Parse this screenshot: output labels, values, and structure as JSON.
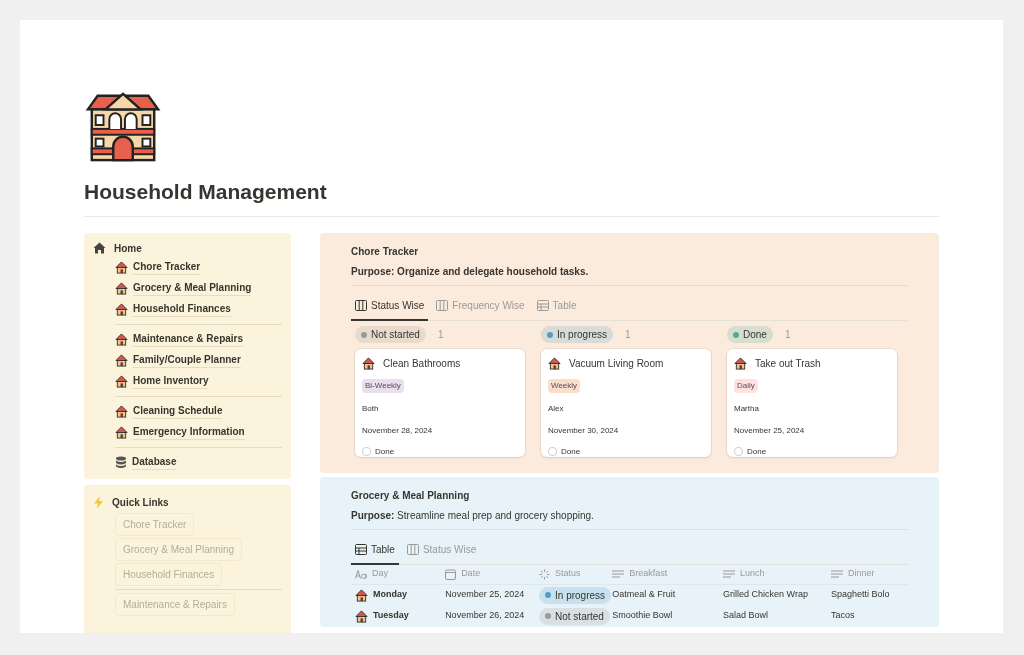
{
  "page": {
    "title": "Household Management"
  },
  "sidebar": {
    "home": {
      "label": "Home"
    },
    "groups": [
      [
        {
          "label": "Chore Tracker",
          "kind": "page"
        },
        {
          "label": "Grocery & Meal Planning",
          "kind": "page"
        },
        {
          "label": "Household Finances",
          "kind": "page"
        }
      ],
      [
        {
          "label": "Maintenance & Repairs",
          "kind": "page"
        },
        {
          "label": "Family/Couple Planner",
          "kind": "page"
        },
        {
          "label": "Home Inventory",
          "kind": "page"
        }
      ],
      [
        {
          "label": "Cleaning Schedule",
          "kind": "page"
        },
        {
          "label": "Emergency Information",
          "kind": "page"
        }
      ],
      [
        {
          "label": "Database",
          "kind": "database"
        }
      ]
    ],
    "quick_links": {
      "title": "Quick Links",
      "groups": [
        [
          "Chore Tracker",
          "Grocery & Meal Planning",
          "Household Finances"
        ],
        [
          "Maintenance & Repairs"
        ]
      ]
    }
  },
  "chore_tracker": {
    "title": "Chore Tracker",
    "purpose": "**Purpose: Organize and delegate household tasks.**",
    "tabs": [
      {
        "label": "Status Wise",
        "kind": "board",
        "selected": true
      },
      {
        "label": "Frequency Wise",
        "kind": "board",
        "selected": false
      },
      {
        "label": "Table",
        "kind": "table",
        "selected": false
      }
    ],
    "columns": [
      {
        "status": "Not started",
        "color": "#9b9a97",
        "count": "1",
        "cards": [
          {
            "title": "Clean Bathrooms",
            "frequency": {
              "label": "Bi-Weekly",
              "color": "#e8deee"
            },
            "assignee": "Both",
            "date": "November 28, 2024",
            "done_label": "Done",
            "checked": false
          }
        ]
      },
      {
        "status": "In progress",
        "color": "#529cca",
        "count": "1",
        "cards": [
          {
            "title": "Vacuum Living Room",
            "frequency": {
              "label": "Weekly",
              "color": "#fadec9"
            },
            "assignee": "Alex",
            "date": "November 30, 2024",
            "done_label": "Done",
            "checked": false
          }
        ]
      },
      {
        "status": "Done",
        "color": "#4dab9a",
        "count": "1",
        "cards": [
          {
            "title": "Take out Trash",
            "frequency": {
              "label": "Daily",
              "color": "#ffe2dd"
            },
            "assignee": "Martha",
            "date": "November 25, 2024",
            "done_label": "Done",
            "checked": false
          }
        ]
      }
    ]
  },
  "meal_planning": {
    "title": "Grocery & Meal Planning",
    "purpose": "**Purpose:** Streamline meal prep and grocery shopping.",
    "tabs": [
      {
        "label": "Table",
        "kind": "table",
        "selected": true
      },
      {
        "label": "Status Wise",
        "kind": "board",
        "selected": false
      }
    ],
    "table": {
      "columns": [
        {
          "label": "Day",
          "kind": "title"
        },
        {
          "label": "Date",
          "kind": "date"
        },
        {
          "label": "Status",
          "kind": "status"
        },
        {
          "label": "Breakfast",
          "kind": "text"
        },
        {
          "label": "Lunch",
          "kind": "text"
        },
        {
          "label": "Dinner",
          "kind": "text"
        }
      ],
      "rows": [
        {
          "day": "Monday",
          "date": "November 25, 2024",
          "status": {
            "label": "In progress",
            "color": "#529cca"
          },
          "breakfast": "Oatmeal & Fruit",
          "lunch": "Grilled Chicken Wrap",
          "dinner": "Spaghetti Bolo"
        },
        {
          "day": "Tuesday",
          "date": "November 26, 2024",
          "status": {
            "label": "Not started",
            "color": "#9b9a97"
          },
          "breakfast": "Smoothie Bowl",
          "lunch": "Salad Bowl",
          "dinner": "Tacos"
        }
      ]
    }
  }
}
